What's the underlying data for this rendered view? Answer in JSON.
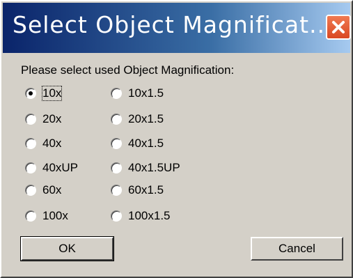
{
  "window": {
    "title": "Select Object Magnificat...",
    "close_icon": "close-icon"
  },
  "prompt": "Please select used Object Magnification:",
  "options_left": [
    {
      "label": "10x",
      "checked": true
    },
    {
      "label": "20x",
      "checked": false
    },
    {
      "label": "40x",
      "checked": false
    },
    {
      "label": "40xUP",
      "checked": false
    },
    {
      "label": "60x",
      "checked": false
    },
    {
      "label": "100x",
      "checked": false
    }
  ],
  "options_right": [
    {
      "label": "10x1.5",
      "checked": false
    },
    {
      "label": "20x1.5",
      "checked": false
    },
    {
      "label": "40x1.5",
      "checked": false
    },
    {
      "label": "40x1.5UP",
      "checked": false
    },
    {
      "label": "60x1.5",
      "checked": false
    },
    {
      "label": "100x1.5",
      "checked": false
    }
  ],
  "buttons": {
    "ok_label": "OK",
    "cancel_label": "Cancel"
  },
  "colors": {
    "title_bar_start": "#0a246a",
    "title_bar_end": "#a6caf0",
    "close_button": "#d94822",
    "face": "#d4d0c8"
  }
}
